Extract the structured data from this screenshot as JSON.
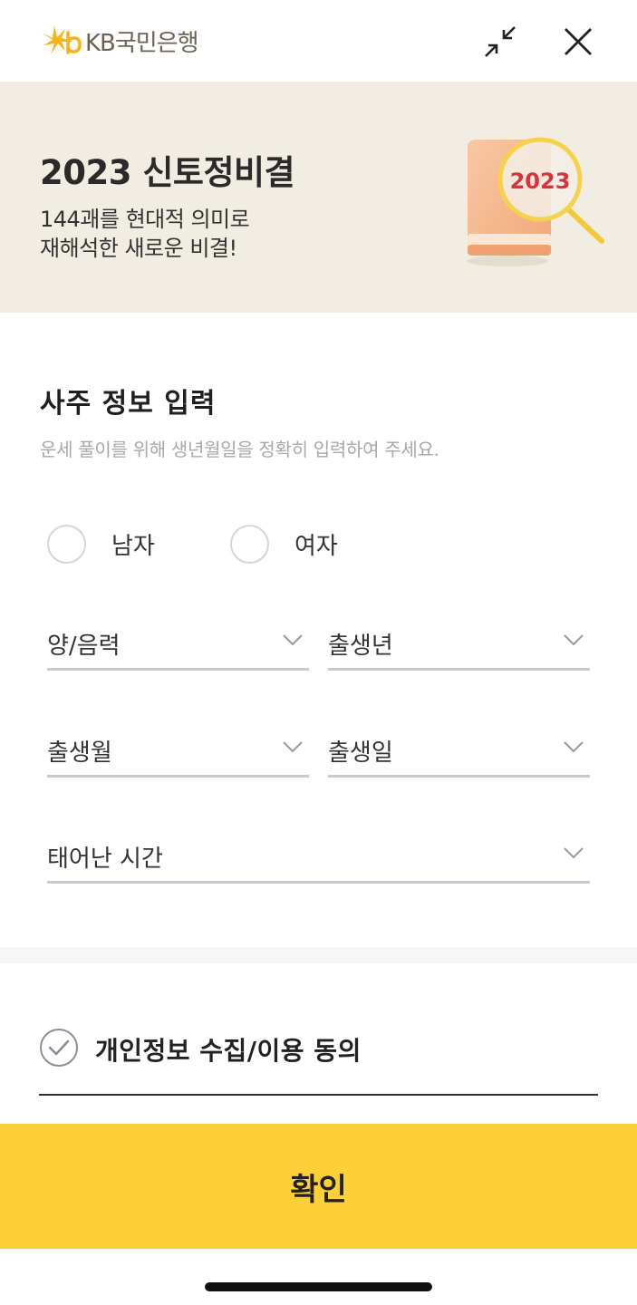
{
  "header": {
    "brand": "KB국민은행",
    "minimize_icon": "minimize-arrows-icon",
    "close_icon": "close-x-icon"
  },
  "banner": {
    "title": "2023 신토정비결",
    "subtitle_line1": "144괘를 현대적 의미로",
    "subtitle_line2": "재해석한 새로운 비결!",
    "book_year": "2023"
  },
  "form": {
    "title": "사주 정보 입력",
    "description": "운세 풀이를 위해 생년월일을 정확히 입력하여 주세요.",
    "gender": {
      "male": "남자",
      "female": "여자"
    },
    "selects": {
      "calendar": "양/음력",
      "year": "출생년",
      "month": "출생월",
      "day": "출생일",
      "time": "태어난 시간"
    }
  },
  "agreement": {
    "label": "개인정보 수집/이용 동의"
  },
  "confirm": {
    "label": "확인"
  },
  "colors": {
    "brand_yellow": "#fcd036",
    "banner_bg": "#f1ede3",
    "logo_star": "#f6b418",
    "book_year_red": "#d8333a"
  }
}
